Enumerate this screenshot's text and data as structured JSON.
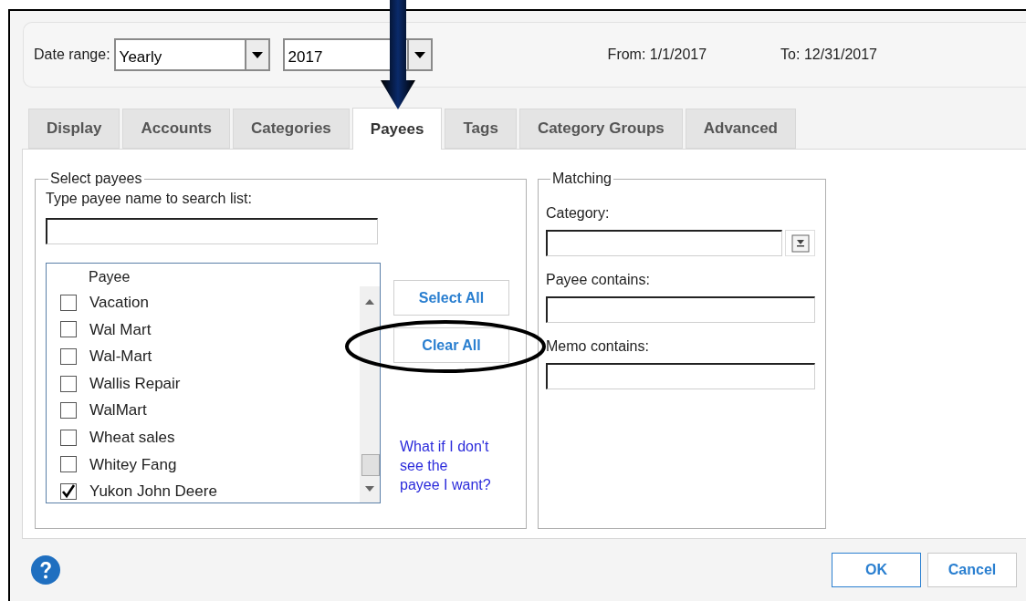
{
  "date_range": {
    "label": "Date range:",
    "period": "Yearly",
    "year": "2017",
    "from": "From: 1/1/2017",
    "to": "To: 12/31/2017"
  },
  "tabs": [
    {
      "label": "Display",
      "selected": false
    },
    {
      "label": "Accounts",
      "selected": false
    },
    {
      "label": "Categories",
      "selected": false
    },
    {
      "label": "Payees",
      "selected": true
    },
    {
      "label": "Tags",
      "selected": false
    },
    {
      "label": "Category Groups",
      "selected": false
    },
    {
      "label": "Advanced",
      "selected": false
    }
  ],
  "select_payees": {
    "title": "Select payees",
    "search_label": "Type payee name to search list:",
    "column": "Payee",
    "items": [
      {
        "name": "Vacation",
        "checked": false
      },
      {
        "name": "Wal Mart",
        "checked": false
      },
      {
        "name": "Wal-Mart",
        "checked": false
      },
      {
        "name": "Wallis Repair",
        "checked": false
      },
      {
        "name": "WalMart",
        "checked": false
      },
      {
        "name": "Wheat sales",
        "checked": false
      },
      {
        "name": "Whitey Fang",
        "checked": false
      },
      {
        "name": "Yukon John Deere",
        "checked": true
      }
    ],
    "buttons": [
      "Select All",
      "Clear All"
    ],
    "help_link": "What if I don't see the payee I want?"
  },
  "matching": {
    "title": "Matching",
    "fields": [
      {
        "label": "Category:",
        "kind": "dropdown"
      },
      {
        "label": "Payee contains:",
        "kind": "text"
      },
      {
        "label": "Memo contains:",
        "kind": "text"
      }
    ]
  },
  "buttons": [
    {
      "label": "OK",
      "default": true
    },
    {
      "label": "Cancel",
      "default": false
    }
  ]
}
